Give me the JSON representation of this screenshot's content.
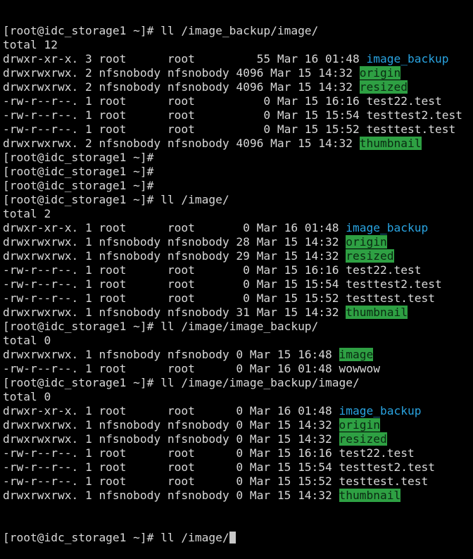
{
  "terminal": {
    "colors": {
      "background": "#000000",
      "foreground": "#d8d8d8",
      "other_writable_dir_bg": "#2ea043",
      "directory_blue": "#29a3e0"
    },
    "lines": [
      {
        "kind": "prompt",
        "text": "[root@idc_storage1 ~]# ll /image_backup/image/"
      },
      {
        "kind": "text",
        "text": "total 12"
      },
      {
        "kind": "entry",
        "prefix": "drwxr-xr-x. 3 root      root         55 Mar 16 01:48 ",
        "name": "image_backup",
        "style": "dir-blue"
      },
      {
        "kind": "entry",
        "prefix": "drwxrwxrwx. 2 nfsnobody nfsnobody 4096 Mar 15 14:32 ",
        "name": "origin",
        "style": "dir-other"
      },
      {
        "kind": "entry",
        "prefix": "drwxrwxrwx. 2 nfsnobody nfsnobody 4096 Mar 15 14:32 ",
        "name": "resized",
        "style": "dir-other"
      },
      {
        "kind": "entry",
        "prefix": "-rw-r--r--. 1 root      root          0 Mar 15 16:16 ",
        "name": "test22.test",
        "style": "plain-file"
      },
      {
        "kind": "entry",
        "prefix": "-rw-r--r--. 1 root      root          0 Mar 15 15:54 ",
        "name": "testtest2.test",
        "style": "plain-file"
      },
      {
        "kind": "entry",
        "prefix": "-rw-r--r--. 1 root      root          0 Mar 15 15:52 ",
        "name": "testtest.test",
        "style": "plain-file"
      },
      {
        "kind": "entry",
        "prefix": "drwxrwxrwx. 2 nfsnobody nfsnobody 4096 Mar 15 14:32 ",
        "name": "thumbnail",
        "style": "dir-other"
      },
      {
        "kind": "prompt",
        "text": "[root@idc_storage1 ~]#"
      },
      {
        "kind": "prompt",
        "text": "[root@idc_storage1 ~]#"
      },
      {
        "kind": "prompt",
        "text": "[root@idc_storage1 ~]#"
      },
      {
        "kind": "prompt",
        "text": "[root@idc_storage1 ~]# ll /image/"
      },
      {
        "kind": "text",
        "text": "total 2"
      },
      {
        "kind": "entry",
        "prefix": "drwxr-xr-x. 1 root      root       0 Mar 16 01:48 ",
        "name": "image_backup",
        "style": "dir-blue"
      },
      {
        "kind": "entry",
        "prefix": "drwxrwxrwx. 1 nfsnobody nfsnobody 28 Mar 15 14:32 ",
        "name": "origin",
        "style": "dir-other"
      },
      {
        "kind": "entry",
        "prefix": "drwxrwxrwx. 1 nfsnobody nfsnobody 29 Mar 15 14:32 ",
        "name": "resized",
        "style": "dir-other"
      },
      {
        "kind": "entry",
        "prefix": "-rw-r--r--. 1 root      root       0 Mar 15 16:16 ",
        "name": "test22.test",
        "style": "plain-file"
      },
      {
        "kind": "entry",
        "prefix": "-rw-r--r--. 1 root      root       0 Mar 15 15:54 ",
        "name": "testtest2.test",
        "style": "plain-file"
      },
      {
        "kind": "entry",
        "prefix": "-rw-r--r--. 1 root      root       0 Mar 15 15:52 ",
        "name": "testtest.test",
        "style": "plain-file"
      },
      {
        "kind": "entry",
        "prefix": "drwxrwxrwx. 1 nfsnobody nfsnobody 31 Mar 15 14:32 ",
        "name": "thumbnail",
        "style": "dir-other"
      },
      {
        "kind": "prompt",
        "text": "[root@idc_storage1 ~]# ll /image/image_backup/"
      },
      {
        "kind": "text",
        "text": "total 0"
      },
      {
        "kind": "entry",
        "prefix": "drwxrwxrwx. 1 nfsnobody nfsnobody 0 Mar 15 16:48 ",
        "name": "image",
        "style": "dir-other"
      },
      {
        "kind": "entry",
        "prefix": "-rw-r--r--. 1 root      root      0 Mar 16 01:48 ",
        "name": "wowwow",
        "style": "plain-file"
      },
      {
        "kind": "prompt",
        "text": "[root@idc_storage1 ~]# ll /image/image_backup/image/"
      },
      {
        "kind": "text",
        "text": "total 0"
      },
      {
        "kind": "entry",
        "prefix": "drwxr-xr-x. 1 root      root      0 Mar 16 01:48 ",
        "name": "image_backup",
        "style": "dir-blue"
      },
      {
        "kind": "entry",
        "prefix": "drwxrwxrwx. 1 nfsnobody nfsnobody 0 Mar 15 14:32 ",
        "name": "origin",
        "style": "dir-other"
      },
      {
        "kind": "entry",
        "prefix": "drwxrwxrwx. 1 nfsnobody nfsnobody 0 Mar 15 14:32 ",
        "name": "resized",
        "style": "dir-other"
      },
      {
        "kind": "entry",
        "prefix": "-rw-r--r--. 1 root      root      0 Mar 15 16:16 ",
        "name": "test22.test",
        "style": "plain-file"
      },
      {
        "kind": "entry",
        "prefix": "-rw-r--r--. 1 root      root      0 Mar 15 15:54 ",
        "name": "testtest2.test",
        "style": "plain-file"
      },
      {
        "kind": "entry",
        "prefix": "-rw-r--r--. 1 root      root      0 Mar 15 15:52 ",
        "name": "testtest.test",
        "style": "plain-file"
      },
      {
        "kind": "entry",
        "prefix": "drwxrwxrwx. 1 nfsnobody nfsnobody 0 Mar 15 14:32 ",
        "name": "thumbnail",
        "style": "dir-other"
      }
    ],
    "current_prompt": "[root@idc_storage1 ~]# ll /image/"
  }
}
